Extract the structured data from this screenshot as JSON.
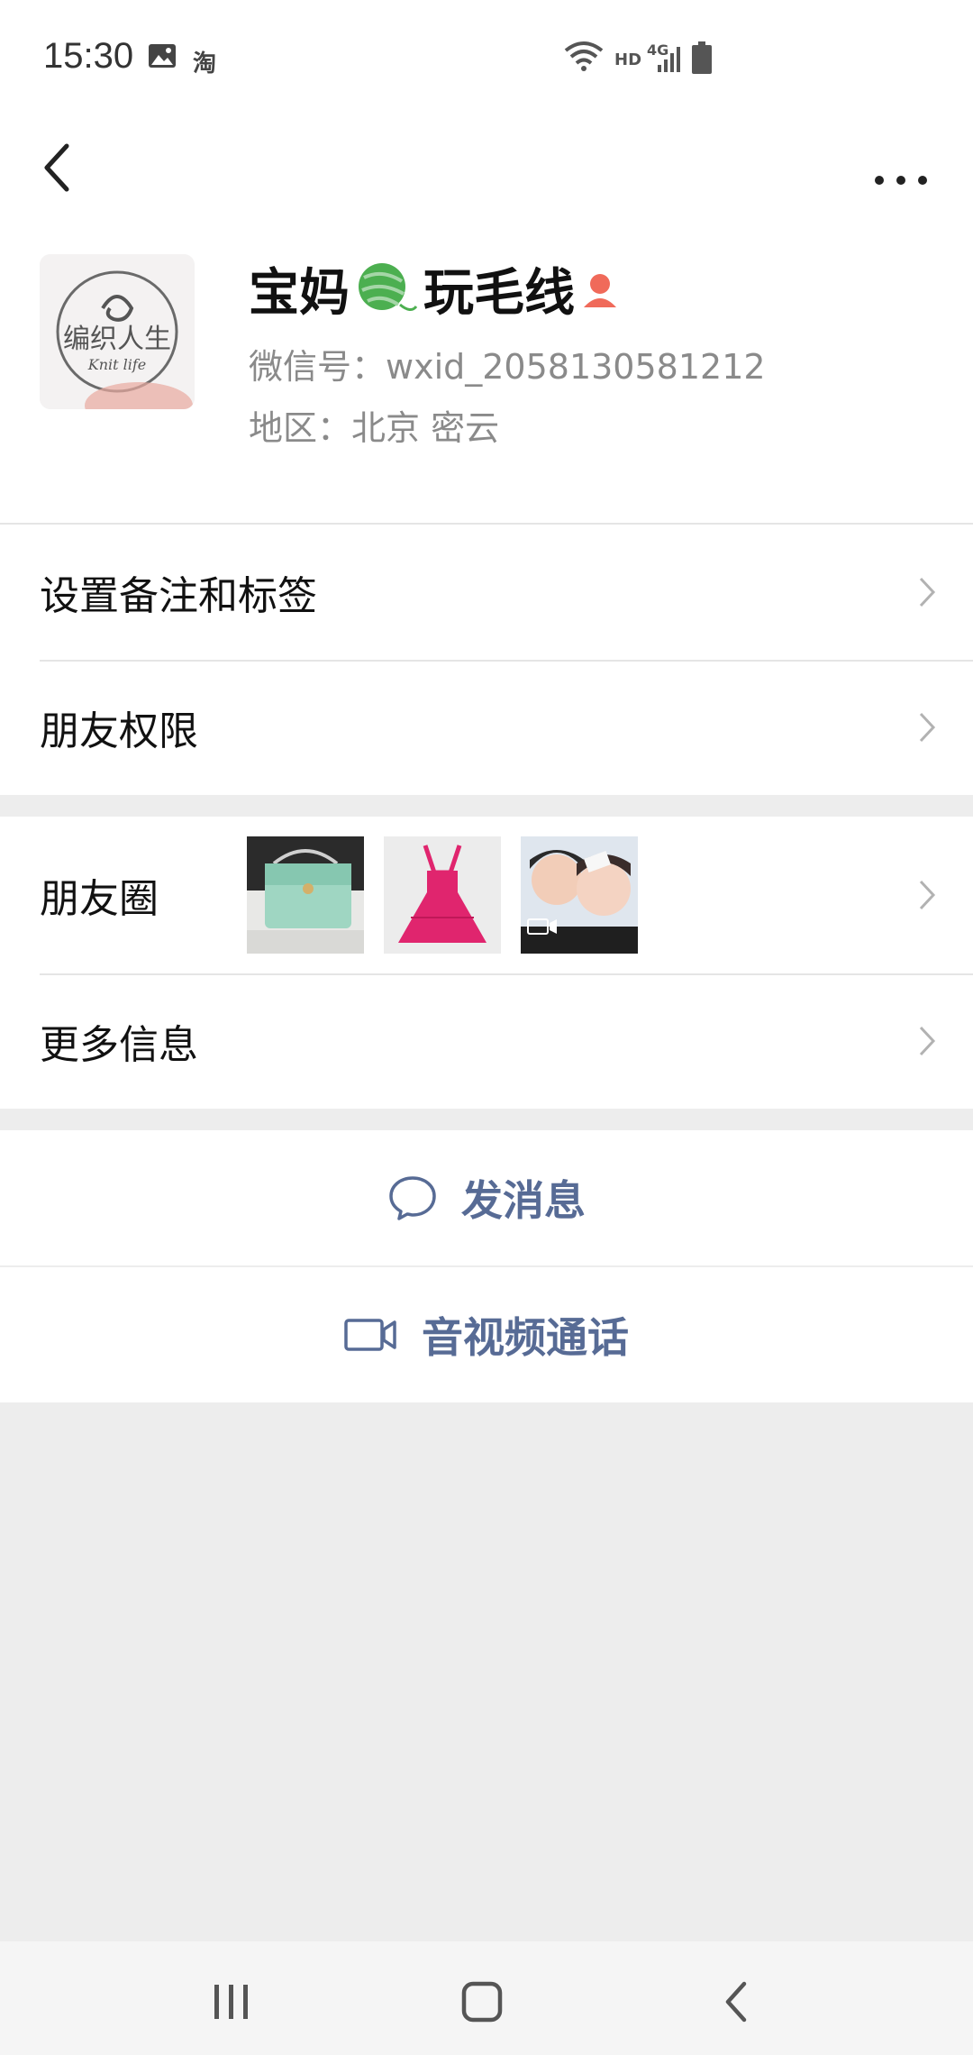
{
  "status_bar": {
    "time": "15:30",
    "taobao_label": "淘",
    "network_hd": "HD",
    "network_gen": "4G",
    "icons": [
      "image-icon",
      "taobao-icon",
      "wifi-icon",
      "signal-icon",
      "battery-icon"
    ]
  },
  "header": {
    "icons": [
      "back-arrow-icon",
      "more-dots-icon"
    ]
  },
  "profile": {
    "avatar_text": "编织人生",
    "avatar_subtext": "Knit life",
    "name_part1": "宝妈",
    "name_part2": "玩毛线",
    "wechat_id": "微信号：wxid_2058130581212",
    "region": "地区：北京  密云",
    "icons": [
      "yarn-ball-icon",
      "gender-female-icon"
    ]
  },
  "menu": {
    "remarks_tags": "设置备注和标签",
    "friend_permissions": "朋友权限",
    "moments": "朋友圈",
    "more_info": "更多信息"
  },
  "actions": {
    "send_message": "发消息",
    "av_call": "音视频通话"
  },
  "colors": {
    "accent_link": "#576b95",
    "page_bg": "#ededed",
    "card_bg": "#ffffff",
    "secondary_text": "#8a8a8a",
    "gender_icon": "#f06a5a"
  }
}
